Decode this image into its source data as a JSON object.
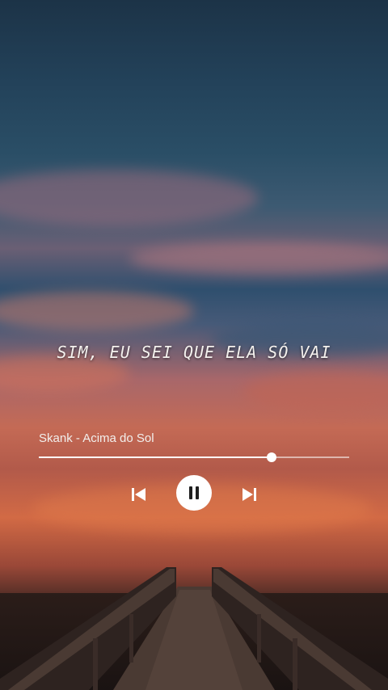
{
  "lyric": {
    "text": "SIM, EU SEI QUE ELA SÓ VAI"
  },
  "player": {
    "track_title": "Skank - Acima do Sol",
    "progress": 0.75,
    "prev_icon": "skip-previous-icon",
    "pause_icon": "pause-icon",
    "next_icon": "skip-next-icon"
  },
  "colors": {
    "accent": "#ffffff",
    "track": "#ffffff8c"
  }
}
